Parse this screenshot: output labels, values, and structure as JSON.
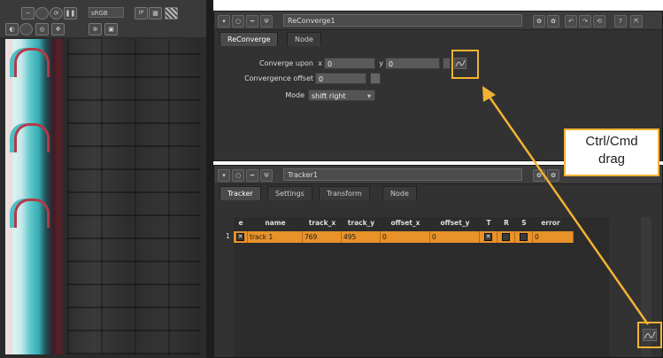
{
  "viewer": {
    "colorspace": "sRGB",
    "ip_label": "IP",
    "toolbar_icons": [
      "minus-icon",
      "circle-icon",
      "refresh-icon",
      "pause-icon",
      "ip-icon",
      "grid-icon",
      "stripes-icon",
      "channel-icon",
      "circle-icon",
      "target-icon",
      "pan-icon",
      "zoom-icon",
      "frame-icon"
    ]
  },
  "reconverge": {
    "node_name": "ReConverge1",
    "tabs": [
      "ReConverge",
      "Node"
    ],
    "converge_label": "Converge upon",
    "x_label": "x",
    "x_value": "0",
    "y_label": "y",
    "y_value": "0",
    "offset_label": "Convergence offset",
    "offset_value": "0",
    "mode_label": "Mode",
    "mode_value": "shift right"
  },
  "tracker": {
    "node_name": "Tracker1",
    "tabs": [
      "Tracker",
      "Settings",
      "Transform",
      "Node"
    ],
    "columns": [
      "e",
      "name",
      "track_x",
      "track_y",
      "offset_x",
      "offset_y",
      "T",
      "R",
      "S",
      "error"
    ],
    "rows": [
      {
        "index": "1",
        "name": "track 1",
        "track_x": "769",
        "track_y": "495",
        "offset_x": "0",
        "offset_y": "0",
        "error": "0"
      }
    ]
  },
  "annotation": {
    "callout_line1": "Ctrl/Cmd",
    "callout_line2": "drag",
    "accent": "#f2b233"
  },
  "colors": {
    "panel_bg": "#323232",
    "row_highlight": "#e8922a"
  }
}
